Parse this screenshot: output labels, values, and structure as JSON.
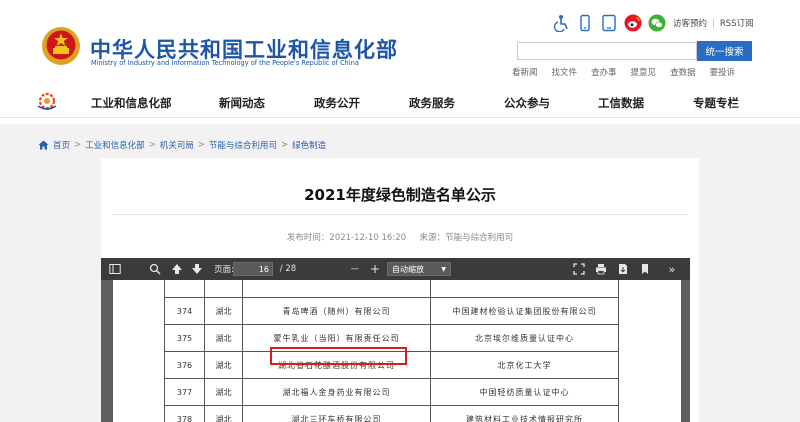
{
  "header": {
    "title": "中华人民共和国工业和信息化部",
    "subtitle": "Ministry of Industry and Information Technology of the People's Republic of China",
    "top_icons": [
      "accessibility-icon",
      "mobile-icon",
      "tablet-icon",
      "weibo-icon",
      "wechat-icon"
    ],
    "top_links": [
      "访客预约",
      "RSS订阅"
    ],
    "search": {
      "value": "",
      "button_label": "统一搜索"
    },
    "quick_links": [
      "看新闻",
      "找文件",
      "查办事",
      "提意见",
      "查数据",
      "要投诉"
    ]
  },
  "nav": {
    "items": [
      "工业和信息化部",
      "新闻动态",
      "政务公开",
      "政务服务",
      "公众参与",
      "工信数据",
      "专题专栏"
    ]
  },
  "breadcrumb": [
    "首页",
    "工业和信息化部",
    "机关司局",
    "节能与综合利用司",
    "绿色制造"
  ],
  "article": {
    "title": "2021年度绿色制造名单公示",
    "publish_label": "发布时间：",
    "publish_time": "2021-12-10 16:20",
    "source_label": "来源：",
    "source": "节能与综合利用司"
  },
  "pdf": {
    "page_label": "页面:",
    "current_page": "16",
    "total_pages": "/ 28",
    "zoom_label": "自动缩放",
    "zoom_minus": "—",
    "zoom_plus": "+",
    "rows": [
      {
        "no": "374",
        "province": "湖北",
        "company": "青岛啤酒（随州）有限公司",
        "org": "中国建材检验认证集团股份有限公司"
      },
      {
        "no": "375",
        "province": "湖北",
        "company": "蒙牛乳业（当阳）有限责任公司",
        "org": "北京埃尔维质量认证中心"
      },
      {
        "no": "376",
        "province": "湖北",
        "company": "湖北省石花酿酒股份有限公司",
        "org": "北京化工大学"
      },
      {
        "no": "377",
        "province": "湖北",
        "company": "湖北福人金身药业有限公司",
        "org": "中国轻纺质量认证中心"
      },
      {
        "no": "378",
        "province": "湖北",
        "company": "湖北三环车桥有限公司",
        "org": "建筑材料工业技术情报研究所"
      }
    ]
  },
  "colors": {
    "brand_blue": "#1d56a6",
    "search_button": "#2a6bc4",
    "highlight": "#e0191c",
    "toolbar": "#3b3b3b"
  }
}
